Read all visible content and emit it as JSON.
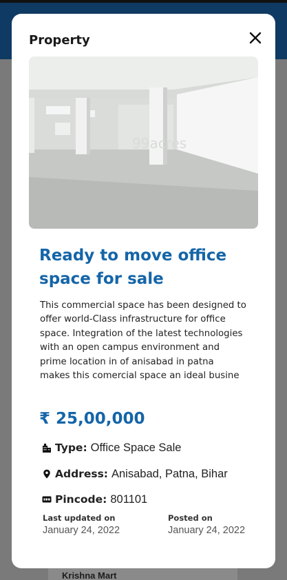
{
  "background": {
    "card_title": "Krishna Mart"
  },
  "modal": {
    "title": "Property",
    "image_watermark": "99acres",
    "property": {
      "title": "Ready to move office space for sale",
      "description": "This commercial space has been designed to offer world-Class infrastructure for office space. Integration of the latest technologies with an open campus environment and prime location in of anisabad in patna makes this comercial space an ideal busine",
      "price": "₹ 25,00,000",
      "type_label": "Type:",
      "type_value": "Office Space Sale",
      "address_label": "Address:",
      "address_value": "Anisabad, Patna, Bihar",
      "pincode_label": "Pincode:",
      "pincode_value": "801101"
    },
    "meta": {
      "last_updated_label": "Last updated on",
      "last_updated_value": "January 24, 2022",
      "posted_label": "Posted on",
      "posted_value": "January 24, 2022"
    }
  },
  "icons": {
    "close": "close-icon",
    "type": "building-icon",
    "address": "map-pin-icon",
    "pincode": "pin-badge-icon"
  },
  "colors": {
    "accent": "#1565a8",
    "header": "#0f3a63",
    "overlay": "#7a7a7a"
  }
}
